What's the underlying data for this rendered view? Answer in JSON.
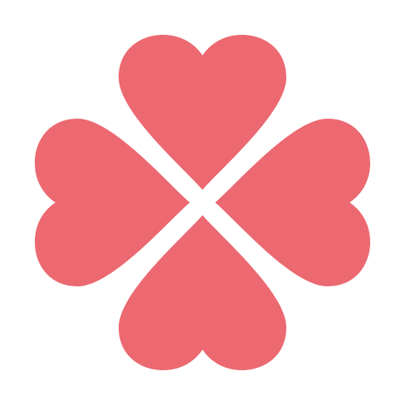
{
  "logo": {
    "icon": "four-leaf-clover-heart-icon",
    "leaf_color": "#ec6971",
    "background_color": "#ffffff"
  }
}
